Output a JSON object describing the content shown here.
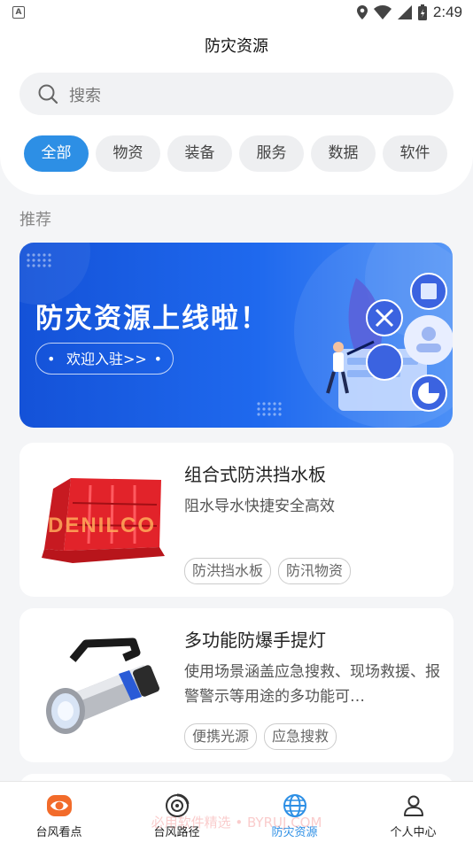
{
  "status_bar": {
    "time": "2:49"
  },
  "header": {
    "title": "防灾资源"
  },
  "search": {
    "placeholder": "搜索"
  },
  "categories": [
    {
      "label": "全部",
      "active": true
    },
    {
      "label": "物资",
      "active": false
    },
    {
      "label": "装备",
      "active": false
    },
    {
      "label": "服务",
      "active": false
    },
    {
      "label": "数据",
      "active": false
    },
    {
      "label": "软件",
      "active": false
    }
  ],
  "section": {
    "label": "推荐"
  },
  "banner": {
    "title": "防灾资源上线啦！",
    "button": "欢迎入驻>>"
  },
  "items": [
    {
      "title": "组合式防洪挡水板",
      "description": "阻水导水快捷安全高效",
      "tags": [
        "防洪挡水板",
        "防汛物资"
      ],
      "image_text": "DENILCO"
    },
    {
      "title": "多功能防爆手提灯",
      "description": "使用场景涵盖应急搜救、现场救援、报警警示等用途的多功能可…",
      "tags": [
        "便携光源",
        "应急搜救"
      ]
    }
  ],
  "tabbar": [
    {
      "label": "台风看点",
      "icon": "eye-icon",
      "active": false
    },
    {
      "label": "台风路径",
      "icon": "typhoon-icon",
      "active": false
    },
    {
      "label": "防灾资源",
      "icon": "globe-icon",
      "active": true
    },
    {
      "label": "个人中心",
      "icon": "person-icon",
      "active": false
    }
  ],
  "watermark": "必用软件精选 • BYRUJ.COM",
  "colors": {
    "accent": "#2d8fe5",
    "banner": "#1f69ee"
  }
}
